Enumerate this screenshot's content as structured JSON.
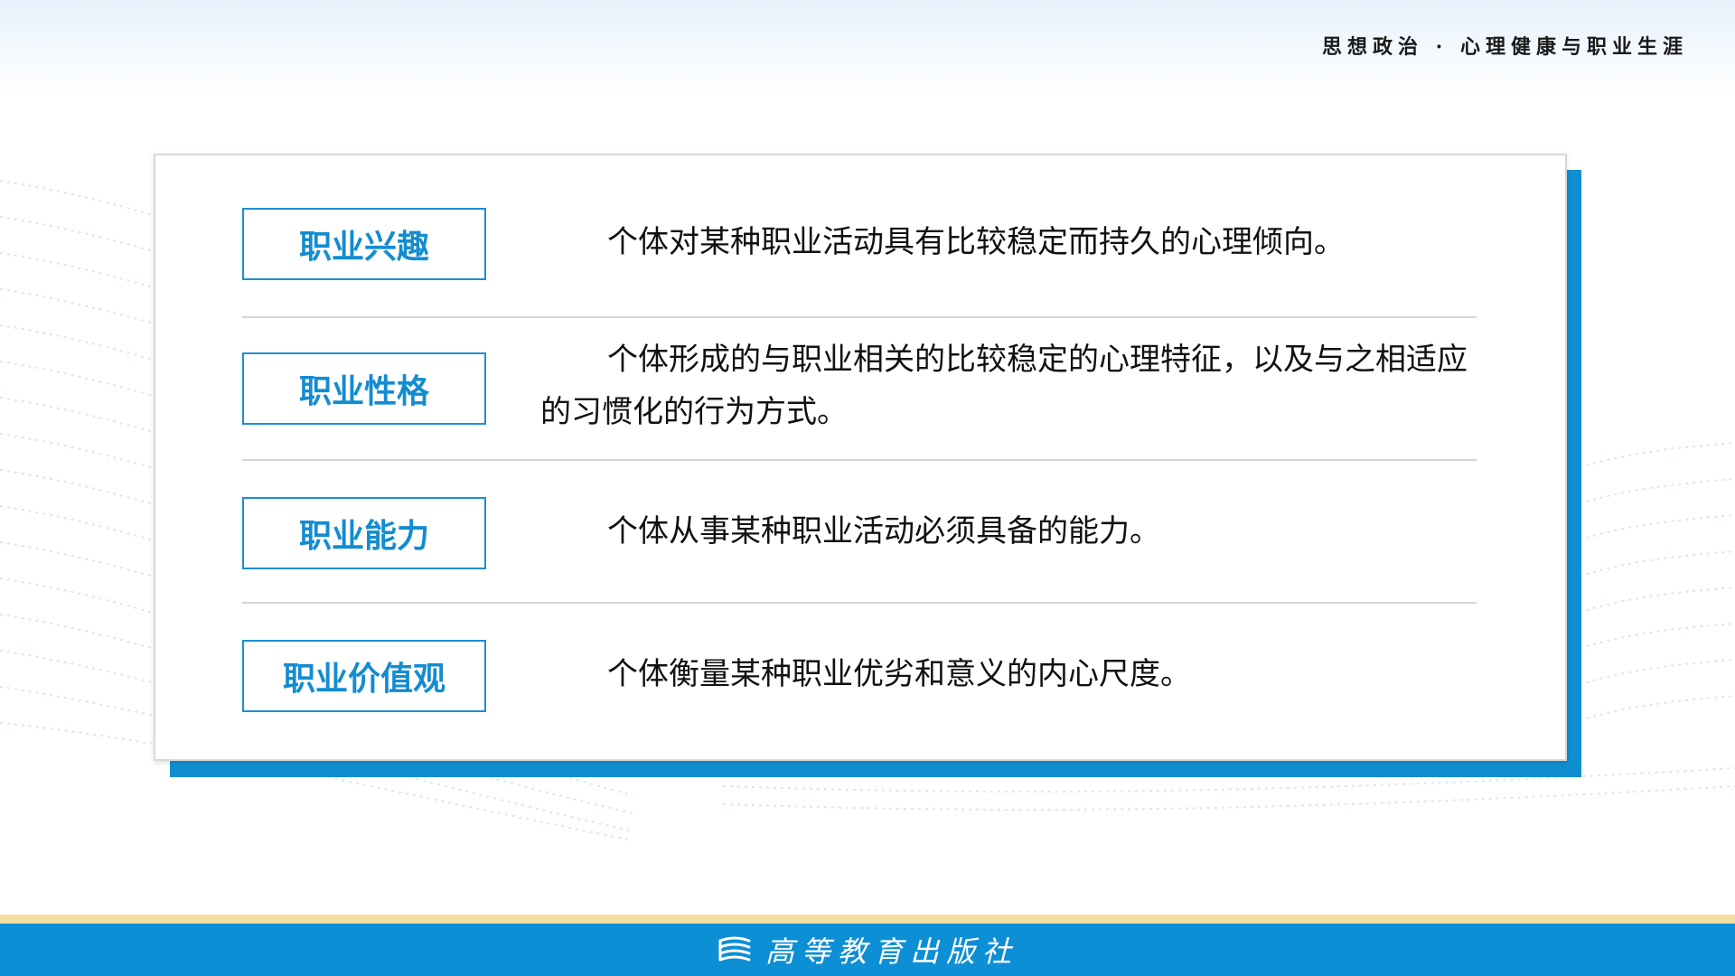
{
  "header": {
    "subtitle": "思想政治 · 心理健康与职业生涯"
  },
  "rows": [
    {
      "label": "职业兴趣",
      "text": "个体对某种职业活动具有比较稳定而持久的心理倾向。"
    },
    {
      "label": "职业性格",
      "text": "个体形成的与职业相关的比较稳定的心理特征，以及与之相适应的习惯化的行为方式。"
    },
    {
      "label": "职业能力",
      "text": "个体从事某种职业活动必须具备的能力。"
    },
    {
      "label": "职业价值观",
      "text": "个体衡量某种职业优劣和意义的内心尺度。"
    }
  ],
  "footer": {
    "publisher": "高等教育出版社",
    "logo_icon": "book-stack-icon"
  },
  "colors": {
    "accent": "#0f8ed1",
    "label_text": "#138cd0",
    "footer_band": "#f3dfa3"
  }
}
